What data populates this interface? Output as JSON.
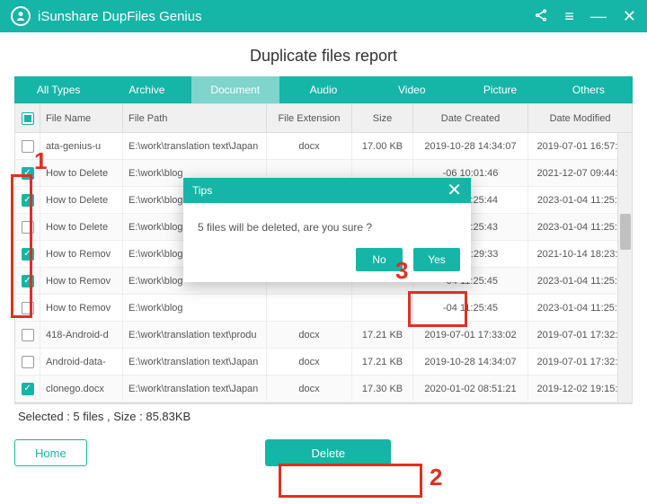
{
  "titlebar": {
    "app_name": "iSunshare DupFiles Genius"
  },
  "report_title": "Duplicate files report",
  "tabs": [
    "All Types",
    "Archive",
    "Document",
    "Audio",
    "Video",
    "Picture",
    "Others"
  ],
  "active_tab": 2,
  "columns": {
    "chk": "",
    "name": "File Name",
    "path": "File Path",
    "ext": "File Extension",
    "size": "Size",
    "created": "Date Created",
    "modified": "Date Modified"
  },
  "rows": [
    {
      "checked": false,
      "name": "ata-genius-u",
      "path": "E:\\work\\translation text\\Japan",
      "ext": "docx",
      "size": "17.00 KB",
      "created": "2019-10-28 14:34:07",
      "modified": "2019-07-01 16:57:4"
    },
    {
      "checked": true,
      "name": "How to Delete",
      "path": "E:\\work\\blog",
      "ext": "",
      "size": "",
      "created": "-06 10:01:46",
      "modified": "2021-12-07 09:44:5"
    },
    {
      "checked": true,
      "name": "How to Delete",
      "path": "E:\\work\\blog",
      "ext": "",
      "size": "",
      "created": "-04 11:25:44",
      "modified": "2023-01-04 11:25:4"
    },
    {
      "checked": false,
      "name": "How to Delete",
      "path": "E:\\work\\blog",
      "ext": "",
      "size": "",
      "created": "-04 11:25:43",
      "modified": "2023-01-04 11:25:4"
    },
    {
      "checked": true,
      "name": "How to Remov",
      "path": "E:\\work\\blog",
      "ext": "",
      "size": "",
      "created": "-14 10:29:33",
      "modified": "2021-10-14 18:23:1"
    },
    {
      "checked": true,
      "name": "How to Remov",
      "path": "E:\\work\\blog",
      "ext": "",
      "size": "",
      "created": "-04 11:25:45",
      "modified": "2023-01-04 11:25:4"
    },
    {
      "checked": false,
      "name": "How to Remov",
      "path": "E:\\work\\blog",
      "ext": "",
      "size": "",
      "created": "-04 11:25:45",
      "modified": "2023-01-04 11:25:4"
    },
    {
      "checked": false,
      "name": "418-Android-d",
      "path": "E:\\work\\translation text\\produ",
      "ext": "docx",
      "size": "17.21 KB",
      "created": "2019-07-01 17:33:02",
      "modified": "2019-07-01 17:32:5"
    },
    {
      "checked": false,
      "name": "Android-data-",
      "path": "E:\\work\\translation text\\Japan",
      "ext": "docx",
      "size": "17.21 KB",
      "created": "2019-10-28 14:34:07",
      "modified": "2019-07-01 17:32:5"
    },
    {
      "checked": true,
      "name": "clonego.docx",
      "path": "E:\\work\\translation text\\Japan",
      "ext": "docx",
      "size": "17.30 KB",
      "created": "2020-01-02 08:51:21",
      "modified": "2019-12-02 19:15:1"
    }
  ],
  "status": "Selected : 5  files ,  Size : 85.83KB",
  "buttons": {
    "home": "Home",
    "delete": "Delete"
  },
  "modal": {
    "title": "Tips",
    "message": "5 files will be deleted, are you sure ?",
    "no": "No",
    "yes": "Yes"
  },
  "annotations": {
    "a1": "1",
    "a2": "2",
    "a3": "3"
  }
}
